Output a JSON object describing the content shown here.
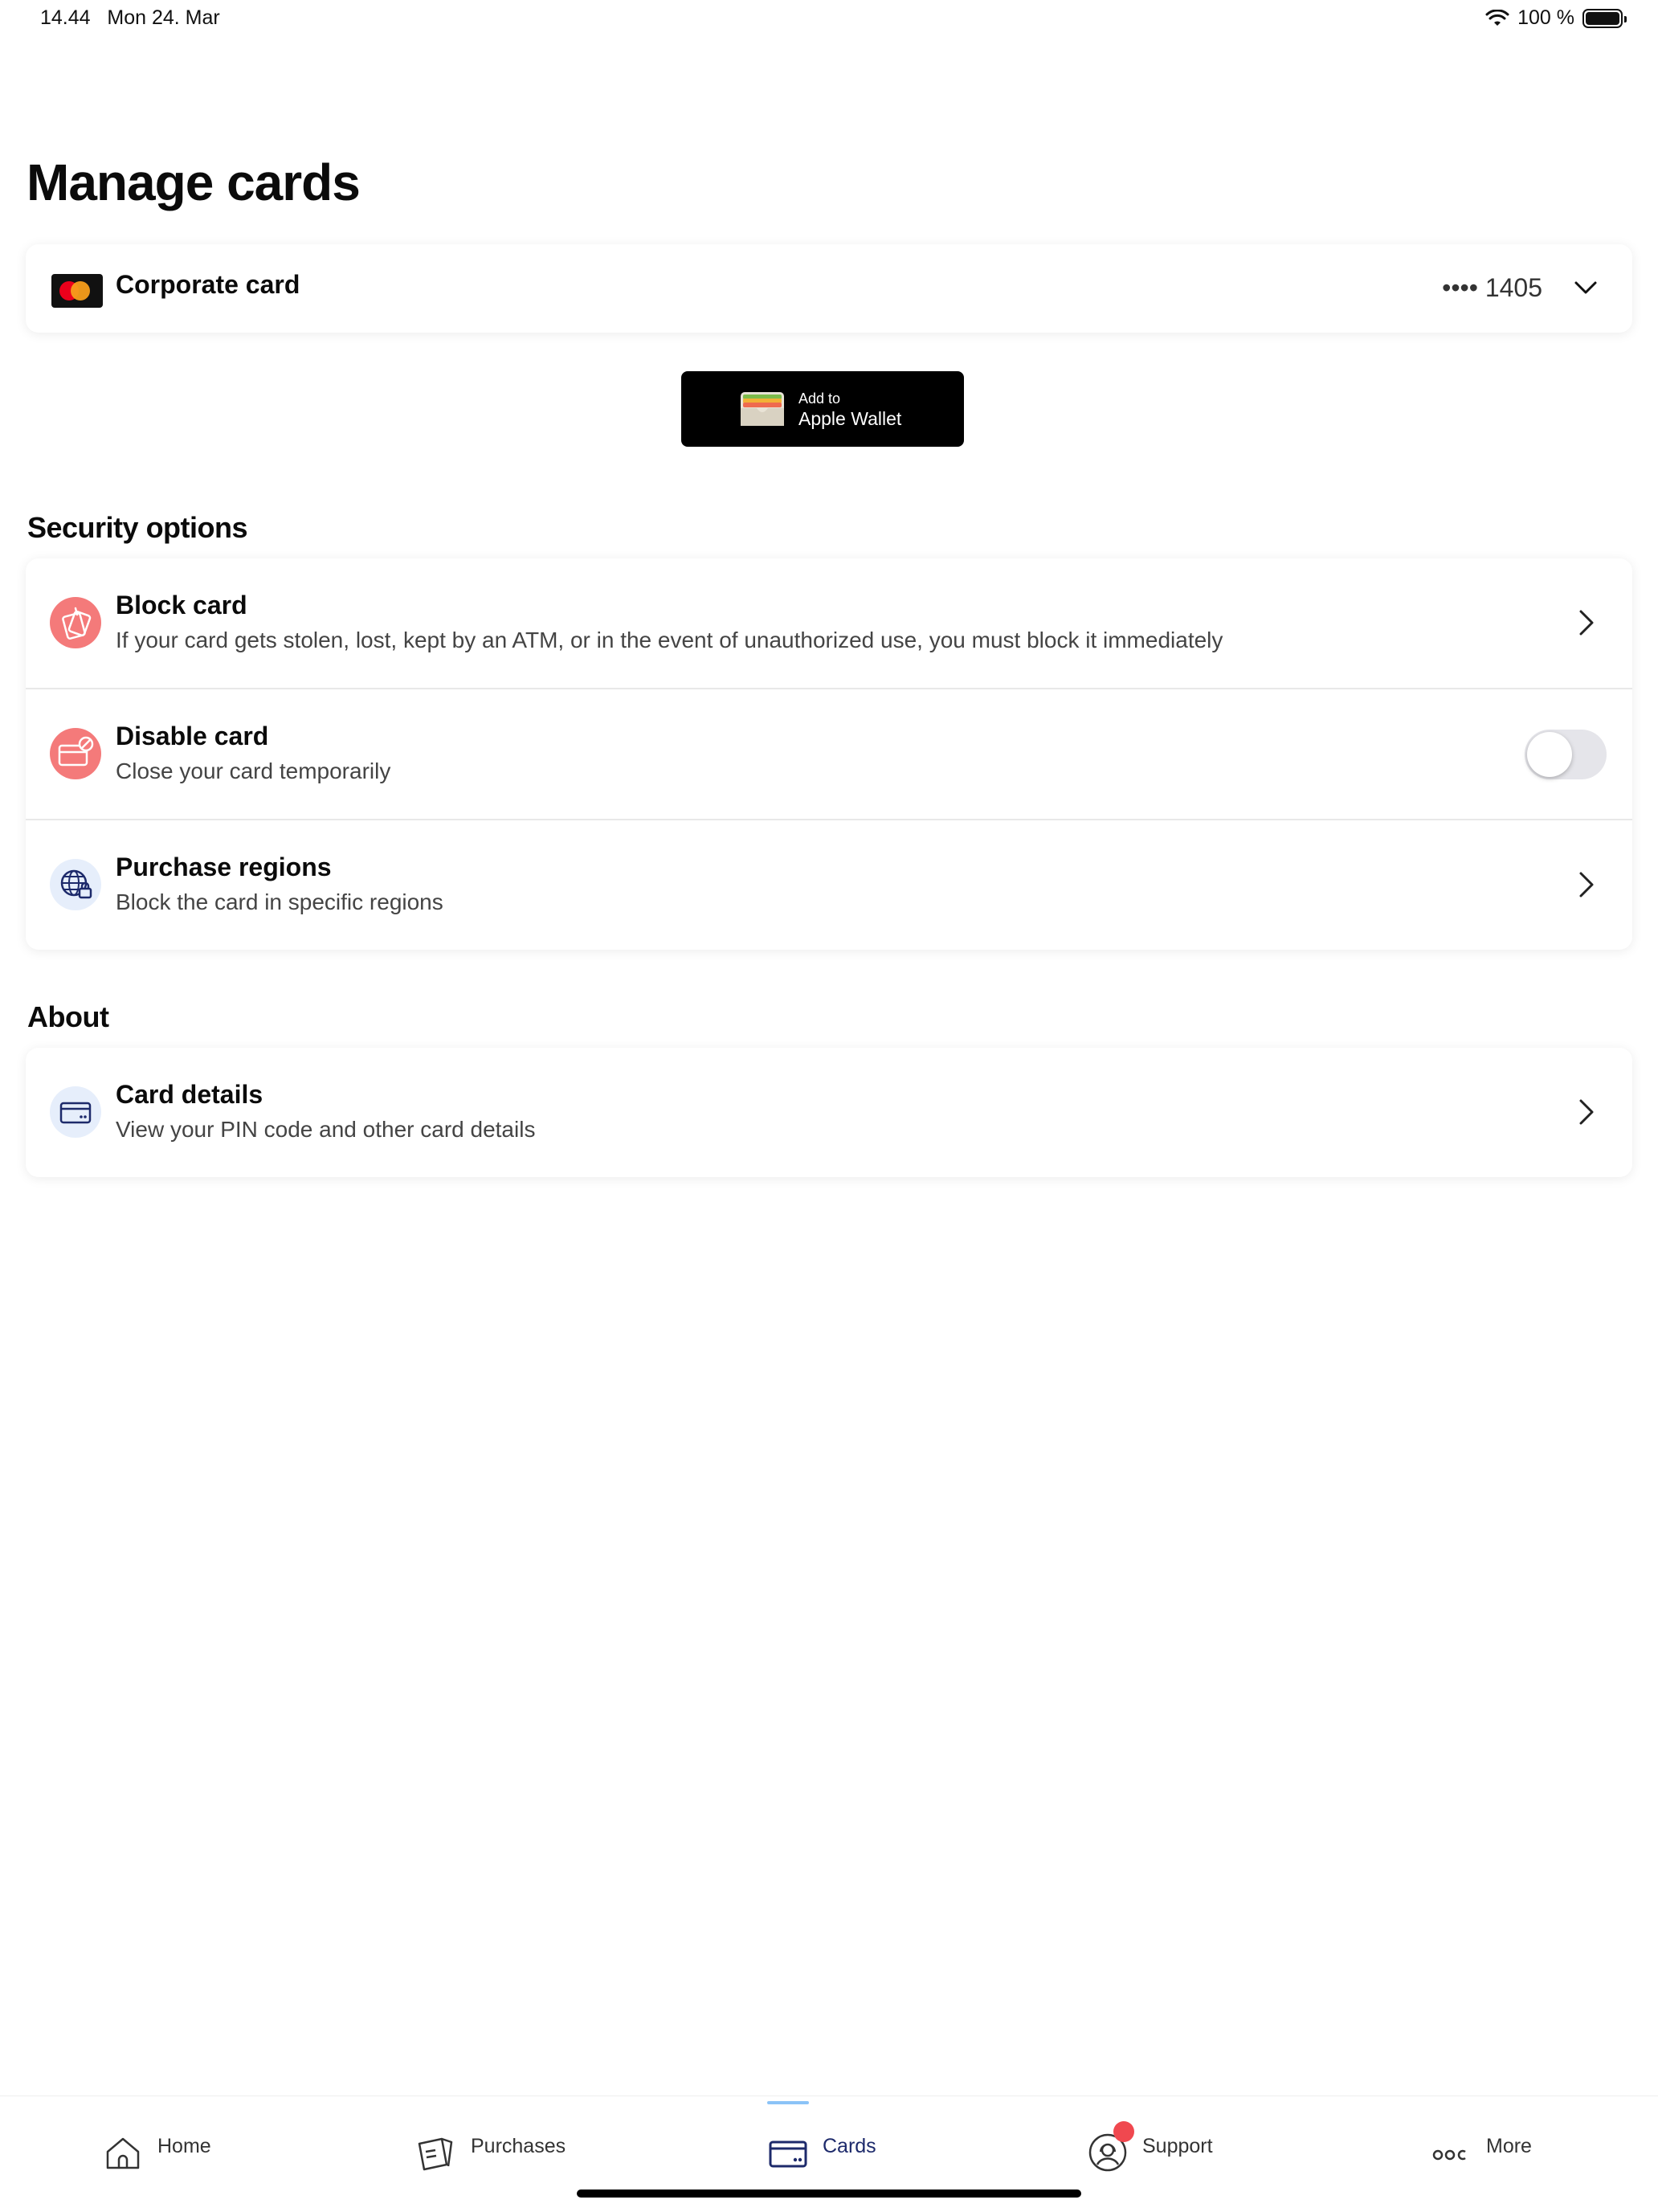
{
  "status_bar": {
    "time": "14.44",
    "date": "Mon 24. Mar",
    "battery": "100 %"
  },
  "page": {
    "title": "Manage cards"
  },
  "card_selector": {
    "name": "Corporate card",
    "masked_number": "•••• 1405"
  },
  "wallet_button": {
    "line1": "Add to",
    "line2": "Apple Wallet"
  },
  "security": {
    "heading": "Security options",
    "items": [
      {
        "title": "Block card",
        "subtitle": "If your card gets stolen, lost, kept by an ATM, or in the event of unauthorized use, you must block it immediately"
      },
      {
        "title": "Disable card",
        "subtitle": "Close your card temporarily",
        "toggle_on": false
      },
      {
        "title": "Purchase regions",
        "subtitle": "Block the card in specific regions"
      }
    ]
  },
  "about": {
    "heading": "About",
    "items": [
      {
        "title": "Card details",
        "subtitle": "View your PIN code and other card details"
      }
    ]
  },
  "tab_bar": {
    "active": "Cards",
    "tabs": [
      {
        "label": "Home",
        "icon": "home-icon"
      },
      {
        "label": "Purchases",
        "icon": "purchases-icon"
      },
      {
        "label": "Cards",
        "icon": "card-icon"
      },
      {
        "label": "Support",
        "icon": "support-icon"
      },
      {
        "label": "More",
        "icon": "more-icon"
      }
    ]
  },
  "colors": {
    "accent_red": "#f0484f",
    "navy": "#1d2a6b",
    "icon_bg_red": "#f47a7a",
    "icon_bg_blue": "#e6eefb"
  }
}
